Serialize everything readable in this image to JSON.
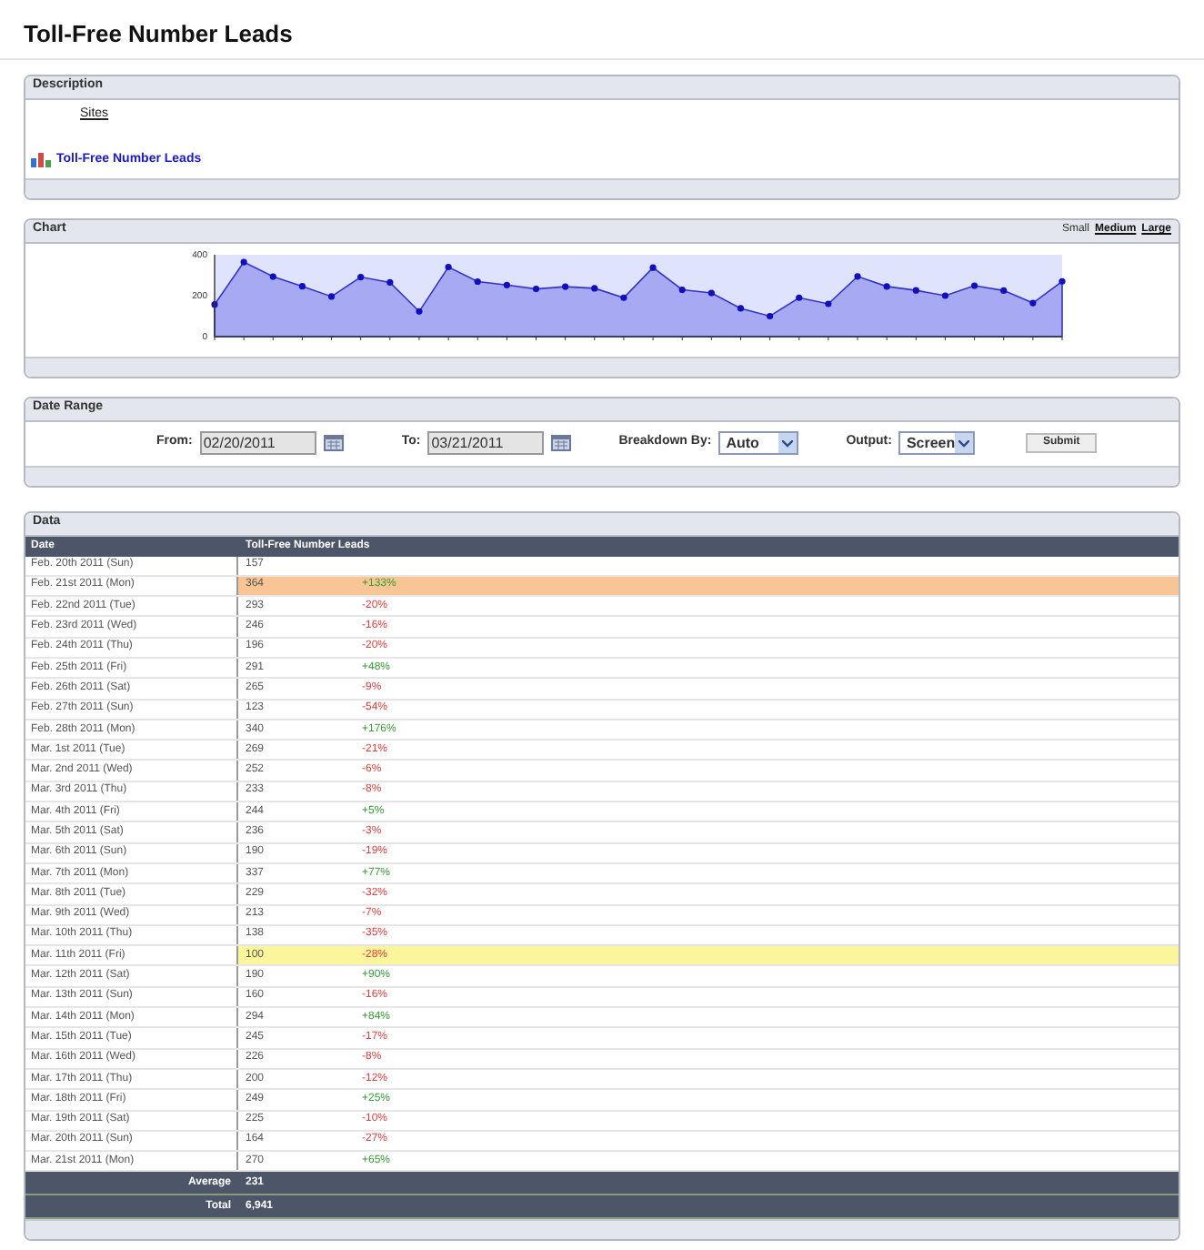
{
  "page_title": "Toll-Free Number Leads",
  "description": {
    "header": "Description",
    "sites_label": "Sites",
    "report_link": "Toll-Free Number Leads"
  },
  "chart": {
    "header": "Chart",
    "sizes": [
      {
        "label": "Small",
        "selected": true
      },
      {
        "label": "Medium",
        "selected": false
      },
      {
        "label": "Large",
        "selected": false
      }
    ],
    "chart_data": {
      "type": "area",
      "yticks": [
        0,
        200,
        400
      ],
      "ylim": [
        0,
        400
      ],
      "series": [
        {
          "color": "#3333cc",
          "values": [
            157,
            364,
            293,
            246,
            196,
            291,
            265,
            123,
            340,
            269,
            252,
            233,
            244,
            236,
            190,
            337,
            229,
            213,
            138,
            100,
            190,
            160,
            294,
            245,
            226,
            200,
            249,
            225,
            164,
            270
          ]
        }
      ]
    }
  },
  "date_range": {
    "header": "Date Range",
    "from_label": "From:",
    "from_value": "02/20/2011",
    "to_label": "To:",
    "to_value": "03/21/2011",
    "breakdown_label": "Breakdown By:",
    "breakdown_value": "Auto",
    "output_label": "Output:",
    "output_value": "Screen",
    "submit": "Submit"
  },
  "data": {
    "header": "Data",
    "columns": [
      "Date",
      "Toll-Free Number Leads"
    ],
    "rows": [
      {
        "date": "Feb. 20th 2011 (Sun)",
        "value": "157"
      },
      {
        "date": "Feb. 21st 2011 (Mon)",
        "value": "364",
        "change": "+133%",
        "increase": true,
        "color": "#f9c595"
      },
      {
        "date": "Feb. 22nd 2011 (Tue)",
        "value": "293",
        "change": "-20%",
        "increase": false
      },
      {
        "date": "Feb. 23rd 2011 (Wed)",
        "value": "246",
        "change": "-16%",
        "increase": false
      },
      {
        "date": "Feb. 24th 2011 (Thu)",
        "value": "196",
        "change": "-20%",
        "increase": false
      },
      {
        "date": "Feb. 25th 2011 (Fri)",
        "value": "291",
        "change": "+48%",
        "increase": true
      },
      {
        "date": "Feb. 26th 2011 (Sat)",
        "value": "265",
        "change": "-9%",
        "increase": false
      },
      {
        "date": "Feb. 27th 2011 (Sun)",
        "value": "123",
        "change": "-54%",
        "increase": false
      },
      {
        "date": "Feb. 28th 2011 (Mon)",
        "value": "340",
        "change": "+176%",
        "increase": true
      },
      {
        "date": "Mar. 1st 2011 (Tue)",
        "value": "269",
        "change": "-21%",
        "increase": false
      },
      {
        "date": "Mar. 2nd 2011 (Wed)",
        "value": "252",
        "change": "-6%",
        "increase": false
      },
      {
        "date": "Mar. 3rd 2011 (Thu)",
        "value": "233",
        "change": "-8%",
        "increase": false
      },
      {
        "date": "Mar. 4th 2011 (Fri)",
        "value": "244",
        "change": "+5%",
        "increase": true
      },
      {
        "date": "Mar. 5th 2011 (Sat)",
        "value": "236",
        "change": "-3%",
        "increase": false
      },
      {
        "date": "Mar. 6th 2011 (Sun)",
        "value": "190",
        "change": "-19%",
        "increase": false
      },
      {
        "date": "Mar. 7th 2011 (Mon)",
        "value": "337",
        "change": "+77%",
        "increase": true
      },
      {
        "date": "Mar. 8th 2011 (Tue)",
        "value": "229",
        "change": "-32%",
        "increase": false
      },
      {
        "date": "Mar. 9th 2011 (Wed)",
        "value": "213",
        "change": "-7%",
        "increase": false
      },
      {
        "date": "Mar. 10th 2011 (Thu)",
        "value": "138",
        "change": "-35%",
        "increase": false
      },
      {
        "date": "Mar. 11th 2011 (Fri)",
        "value": "100",
        "change": "-28%",
        "increase": false,
        "color": "#fbf59c"
      },
      {
        "date": "Mar. 12th 2011 (Sat)",
        "value": "190",
        "change": "+90%",
        "increase": true
      },
      {
        "date": "Mar. 13th 2011 (Sun)",
        "value": "160",
        "change": "-16%",
        "increase": false
      },
      {
        "date": "Mar. 14th 2011 (Mon)",
        "value": "294",
        "change": "+84%",
        "increase": true
      },
      {
        "date": "Mar. 15th 2011 (Tue)",
        "value": "245",
        "change": "-17%",
        "increase": false
      },
      {
        "date": "Mar. 16th 2011 (Wed)",
        "value": "226",
        "change": "-8%",
        "increase": false
      },
      {
        "date": "Mar. 17th 2011 (Thu)",
        "value": "200",
        "change": "-12%",
        "increase": false
      },
      {
        "date": "Mar. 18th 2011 (Fri)",
        "value": "249",
        "change": "+25%",
        "increase": true
      },
      {
        "date": "Mar. 19th 2011 (Sat)",
        "value": "225",
        "change": "-10%",
        "increase": false
      },
      {
        "date": "Mar. 20th 2011 (Sun)",
        "value": "164",
        "change": "-27%",
        "increase": false
      },
      {
        "date": "Mar. 21st 2011 (Mon)",
        "value": "270",
        "change": "+65%",
        "increase": true
      }
    ],
    "summary": [
      {
        "label": "Average",
        "value": "231"
      },
      {
        "label": "Total",
        "value": "6,941"
      }
    ]
  }
}
